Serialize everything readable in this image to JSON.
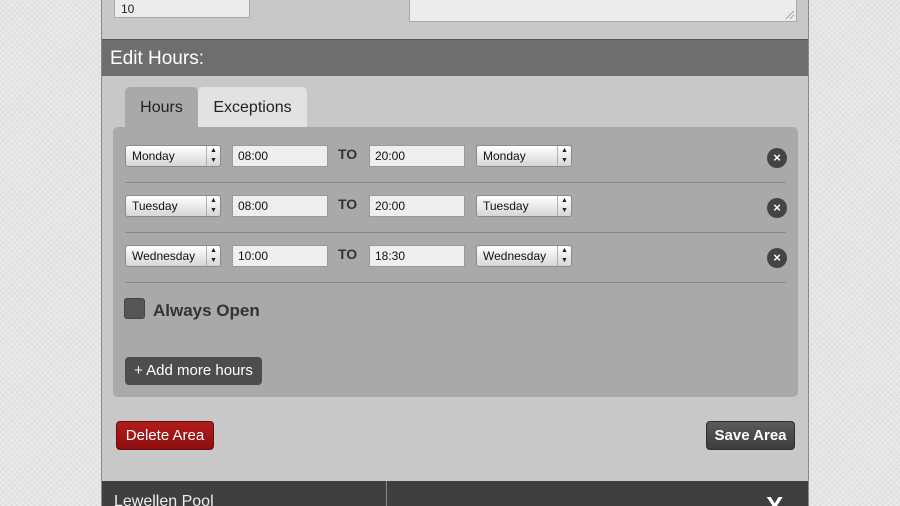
{
  "top": {
    "input_value": "10"
  },
  "section": {
    "title": "Edit Hours:"
  },
  "tabs": [
    {
      "label": "Hours",
      "active": true
    },
    {
      "label": "Exceptions",
      "active": false
    }
  ],
  "rows": [
    {
      "from_day": "Monday",
      "from_time": "08:00",
      "to_label": "TO",
      "to_time": "20:00",
      "to_day": "Monday",
      "remove": "×"
    },
    {
      "from_day": "Tuesday",
      "from_time": "08:00",
      "to_label": "TO",
      "to_time": "20:00",
      "to_day": "Tuesday",
      "remove": "×"
    },
    {
      "from_day": "Wednesday",
      "from_time": "10:00",
      "to_label": "TO",
      "to_time": "18:30",
      "to_day": "Wednesday",
      "remove": "×"
    }
  ],
  "always_open": {
    "label": "Always Open",
    "checked": false
  },
  "buttons": {
    "add_more": "+ Add more hours",
    "delete": "Delete Area",
    "save": "Save Area"
  },
  "footer": {
    "title": "Lewellen Pool",
    "close": "X"
  },
  "colors": {
    "delete": "#a51616",
    "header": "#6e6e6e",
    "panel": "#c8c8c8"
  }
}
